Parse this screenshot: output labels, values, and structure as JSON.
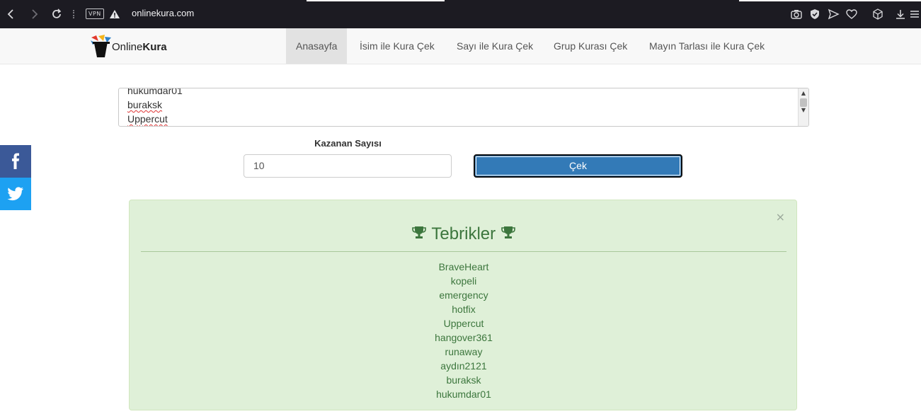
{
  "browser": {
    "url": "onlinekura.com",
    "vpn_label": "VPN"
  },
  "site": {
    "logo_part1": "Online",
    "logo_part2": "Kura",
    "nav": [
      {
        "label": "Anasayfa",
        "active": true
      },
      {
        "label": "İsim ile Kura Çek"
      },
      {
        "label": "Sayı ile Kura Çek"
      },
      {
        "label": "Grup Kurası Çek"
      },
      {
        "label": "Mayın Tarlası ile Kura Çek"
      }
    ]
  },
  "form": {
    "names_visible": [
      "hukumdar01",
      "buraksk",
      "Uppercut"
    ],
    "winner_count_label": "Kazanan Sayısı",
    "winner_count_value": "10",
    "draw_button": "Çek"
  },
  "result": {
    "title": "Tebrikler",
    "close": "×",
    "winners": [
      "BraveHeart",
      "kopeli",
      "emergency",
      "hotfix",
      "Uppercut",
      "hangover361",
      "runaway",
      "aydın2121",
      "buraksk",
      "hukumdar01"
    ]
  },
  "social": [
    {
      "name": "facebook",
      "icon": "facebook-icon",
      "color": "#3b5998"
    },
    {
      "name": "twitter",
      "icon": "twitter-icon",
      "color": "#1da1f2"
    }
  ],
  "colors": {
    "primary_button": "#337ab7",
    "alert_bg": "#dff0d8",
    "alert_text": "#3c763d"
  }
}
